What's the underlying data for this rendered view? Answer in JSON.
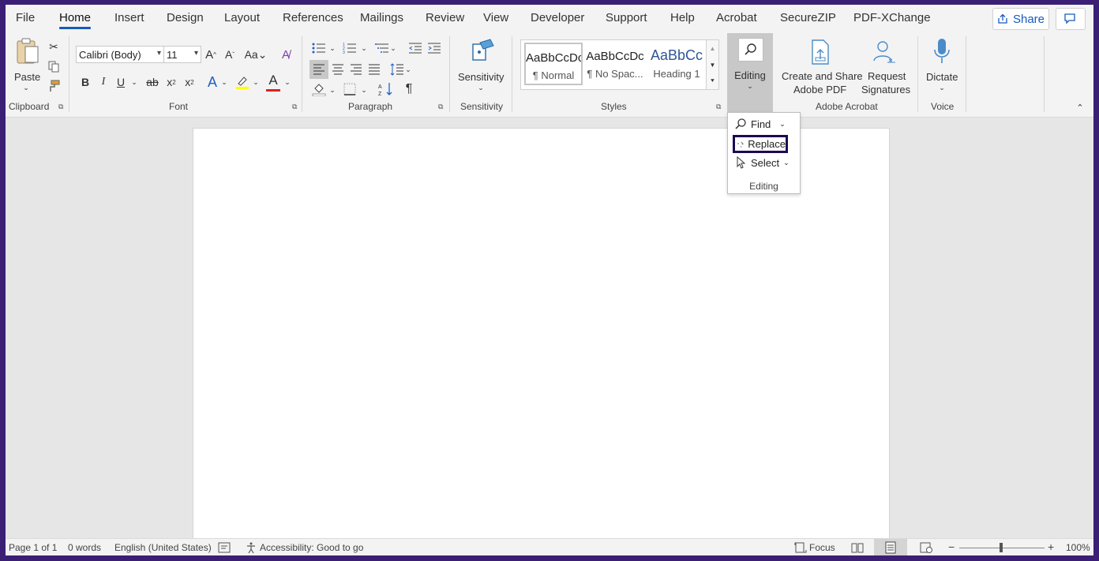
{
  "tabs": [
    "File",
    "Home",
    "Insert",
    "Design",
    "Layout",
    "References",
    "Mailings",
    "Review",
    "View",
    "Developer",
    "Support",
    "Help",
    "Acrobat",
    "SecureZIP",
    "PDF-XChange"
  ],
  "active_tab": "Home",
  "share_label": "Share",
  "clipboard": {
    "paste_label": "Paste",
    "group_label": "Clipboard"
  },
  "font": {
    "name": "Calibri (Body)",
    "size": "11",
    "group_label": "Font"
  },
  "paragraph": {
    "group_label": "Paragraph"
  },
  "sensitivity": {
    "label": "Sensitivity",
    "group_label": "Sensitivity"
  },
  "styles": {
    "group_label": "Styles",
    "items": [
      {
        "sample": "AaBbCcDc",
        "name": "¶ Normal"
      },
      {
        "sample": "AaBbCcDc",
        "name": "¶ No Spac..."
      },
      {
        "sample": "AaBbCc",
        "name": "Heading 1"
      }
    ]
  },
  "editing": {
    "label": "Editing",
    "group_label": "Editing"
  },
  "acrobat": {
    "create_label": "Create and Share",
    "create_label2": "Adobe PDF",
    "request_label": "Request",
    "request_label2": "Signatures",
    "group_label": "Adobe Acrobat"
  },
  "voice": {
    "dictate_label": "Dictate",
    "group_label": "Voice"
  },
  "dropdown": {
    "find": "Find",
    "replace": "Replace",
    "select": "Select",
    "group_label": "Editing"
  },
  "status": {
    "page": "Page 1 of 1",
    "words": "0 words",
    "language": "English (United States)",
    "accessibility": "Accessibility: Good to go",
    "focus": "Focus",
    "zoom": "100%"
  },
  "colors": {
    "accent": "#185abd",
    "highlight_border": "#1b0a52",
    "frame": "#3a1f75"
  }
}
